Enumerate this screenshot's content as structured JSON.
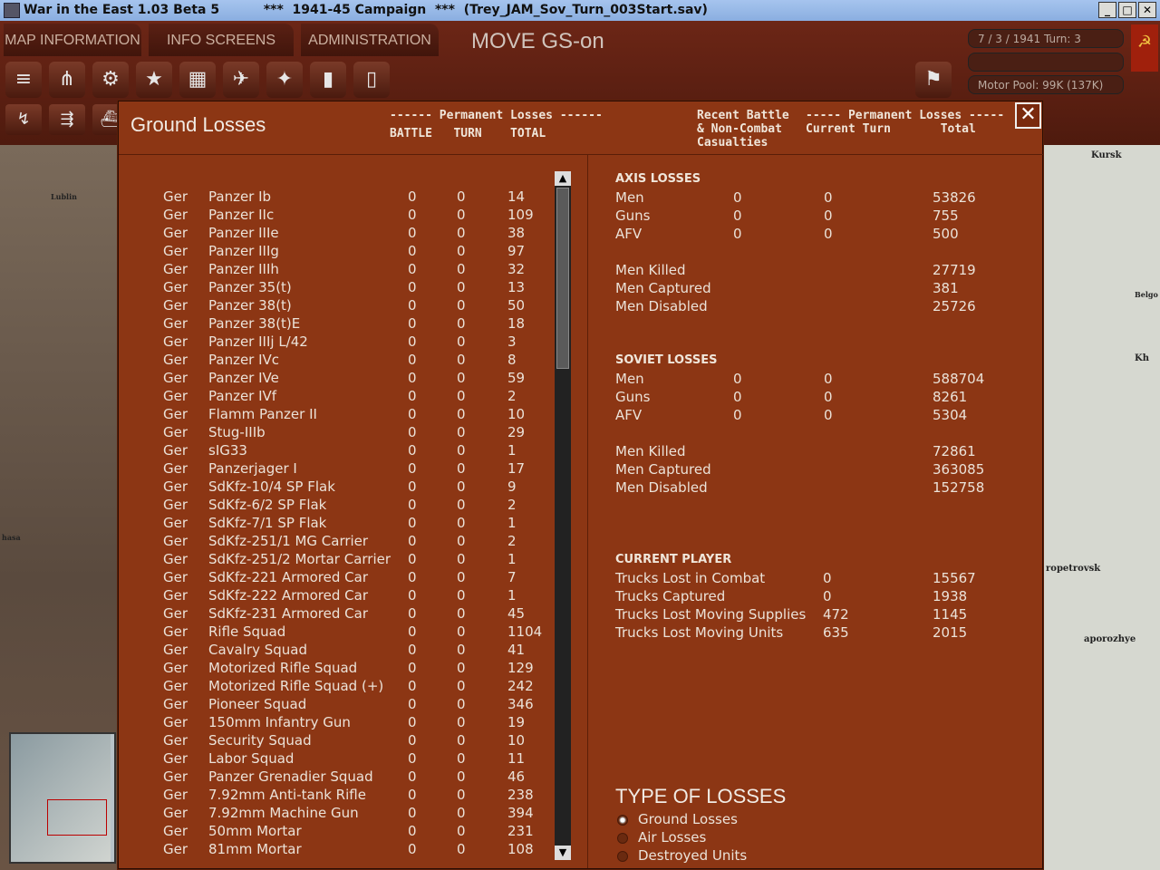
{
  "window": {
    "title": "War in the East 1.03 Beta 5          ***  1941-45 Campaign  ***  (Trey_JAM_Sov_Turn_003Start.sav)",
    "min": "_",
    "max": "□",
    "close": "✕"
  },
  "menu": {
    "tabs": [
      "MAP INFORMATION",
      "INFO SCREENS",
      "ADMINISTRATION"
    ],
    "mode": "MOVE  GS-on"
  },
  "status": {
    "date_turn": "7 / 3 / 1941   Turn: 3",
    "motor_pool": "Motor Pool:  99K (137K)"
  },
  "map": {
    "labels": [
      "Kursk",
      "Lublin",
      "Belgo",
      "Kh",
      "ropetrovsk",
      "aporozhye",
      "hasa"
    ]
  },
  "dialog": {
    "title": "Ground Losses",
    "hdr_perm": "------ Permanent Losses ------",
    "hdr_cols": "BATTLE   TURN    TOTAL",
    "hdr_recent": "Recent Battle\n& Non-Combat\nCasualties",
    "hdr_perm2": "----- Permanent Losses -----\nCurrent Turn       Total",
    "close": "✕",
    "rows": [
      [
        "Ger",
        "Panzer Ib",
        "0",
        "0",
        "14"
      ],
      [
        "Ger",
        "Panzer IIc",
        "0",
        "0",
        "109"
      ],
      [
        "Ger",
        "Panzer IIIe",
        "0",
        "0",
        "38"
      ],
      [
        "Ger",
        "Panzer IIIg",
        "0",
        "0",
        "97"
      ],
      [
        "Ger",
        "Panzer IIIh",
        "0",
        "0",
        "32"
      ],
      [
        "Ger",
        "Panzer 35(t)",
        "0",
        "0",
        "13"
      ],
      [
        "Ger",
        "Panzer 38(t)",
        "0",
        "0",
        "50"
      ],
      [
        "Ger",
        "Panzer 38(t)E",
        "0",
        "0",
        "18"
      ],
      [
        "Ger",
        "Panzer IIIj L/42",
        "0",
        "0",
        "3"
      ],
      [
        "Ger",
        "Panzer IVc",
        "0",
        "0",
        "8"
      ],
      [
        "Ger",
        "Panzer IVe",
        "0",
        "0",
        "59"
      ],
      [
        "Ger",
        "Panzer IVf",
        "0",
        "0",
        "2"
      ],
      [
        "Ger",
        "Flamm Panzer II",
        "0",
        "0",
        "10"
      ],
      [
        "Ger",
        "Stug-IIIb",
        "0",
        "0",
        "29"
      ],
      [
        "Ger",
        "sIG33",
        "0",
        "0",
        "1"
      ],
      [
        "Ger",
        "Panzerjager I",
        "0",
        "0",
        "17"
      ],
      [
        "Ger",
        "SdKfz-10/4 SP Flak",
        "0",
        "0",
        "9"
      ],
      [
        "Ger",
        "SdKfz-6/2 SP Flak",
        "0",
        "0",
        "2"
      ],
      [
        "Ger",
        "SdKfz-7/1 SP Flak",
        "0",
        "0",
        "1"
      ],
      [
        "Ger",
        "SdKfz-251/1 MG Carrier",
        "0",
        "0",
        "2"
      ],
      [
        "Ger",
        "SdKfz-251/2 Mortar Carrier",
        "0",
        "0",
        "1"
      ],
      [
        "Ger",
        "SdKfz-221 Armored Car",
        "0",
        "0",
        "7"
      ],
      [
        "Ger",
        "SdKfz-222 Armored Car",
        "0",
        "0",
        "1"
      ],
      [
        "Ger",
        "SdKfz-231 Armored Car",
        "0",
        "0",
        "45"
      ],
      [
        "Ger",
        "Rifle Squad",
        "0",
        "0",
        "1104"
      ],
      [
        "Ger",
        "Cavalry Squad",
        "0",
        "0",
        "41"
      ],
      [
        "Ger",
        "Motorized Rifle Squad",
        "0",
        "0",
        "129"
      ],
      [
        "Ger",
        "Motorized Rifle Squad (+)",
        "0",
        "0",
        "242"
      ],
      [
        "Ger",
        "Pioneer Squad",
        "0",
        "0",
        "346"
      ],
      [
        "Ger",
        "150mm Infantry Gun",
        "0",
        "0",
        "19"
      ],
      [
        "Ger",
        "Security Squad",
        "0",
        "0",
        "10"
      ],
      [
        "Ger",
        "Labor Squad",
        "0",
        "0",
        "11"
      ],
      [
        "Ger",
        "Panzer Grenadier Squad",
        "0",
        "0",
        "46"
      ],
      [
        "Ger",
        "7.92mm Anti-tank Rifle",
        "0",
        "0",
        "238"
      ],
      [
        "Ger",
        "7.92mm Machine Gun",
        "0",
        "0",
        "394"
      ],
      [
        "Ger",
        "50mm Mortar",
        "0",
        "0",
        "231"
      ],
      [
        "Ger",
        "81mm Mortar",
        "0",
        "0",
        "108"
      ]
    ],
    "axis": {
      "title": "AXIS LOSSES",
      "rows": [
        [
          "Men",
          "0",
          "0",
          "53826"
        ],
        [
          "Guns",
          "0",
          "0",
          "755"
        ],
        [
          "AFV",
          "0",
          "0",
          "500"
        ]
      ],
      "killed": [
        "Men Killed",
        "27719"
      ],
      "captured": [
        "Men Captured",
        "381"
      ],
      "disabled": [
        "Men Disabled",
        "25726"
      ]
    },
    "soviet": {
      "title": "SOVIET LOSSES",
      "rows": [
        [
          "Men",
          "0",
          "0",
          "588704"
        ],
        [
          "Guns",
          "0",
          "0",
          "8261"
        ],
        [
          "AFV",
          "0",
          "0",
          "5304"
        ]
      ],
      "killed": [
        "Men Killed",
        "72861"
      ],
      "captured": [
        "Men Captured",
        "363085"
      ],
      "disabled": [
        "Men Disabled",
        "152758"
      ]
    },
    "player": {
      "title": "CURRENT PLAYER",
      "rows": [
        [
          "Trucks Lost in Combat",
          "0",
          "15567"
        ],
        [
          "Trucks Captured",
          "0",
          "1938"
        ],
        [
          "Trucks Lost Moving Supplies",
          "472",
          "1145"
        ],
        [
          "Trucks Lost Moving Units",
          "635",
          "2015"
        ]
      ]
    },
    "type": {
      "title": "TYPE OF LOSSES",
      "options": [
        "Ground Losses",
        "Air Losses",
        "Destroyed Units"
      ],
      "selected": 0
    }
  }
}
